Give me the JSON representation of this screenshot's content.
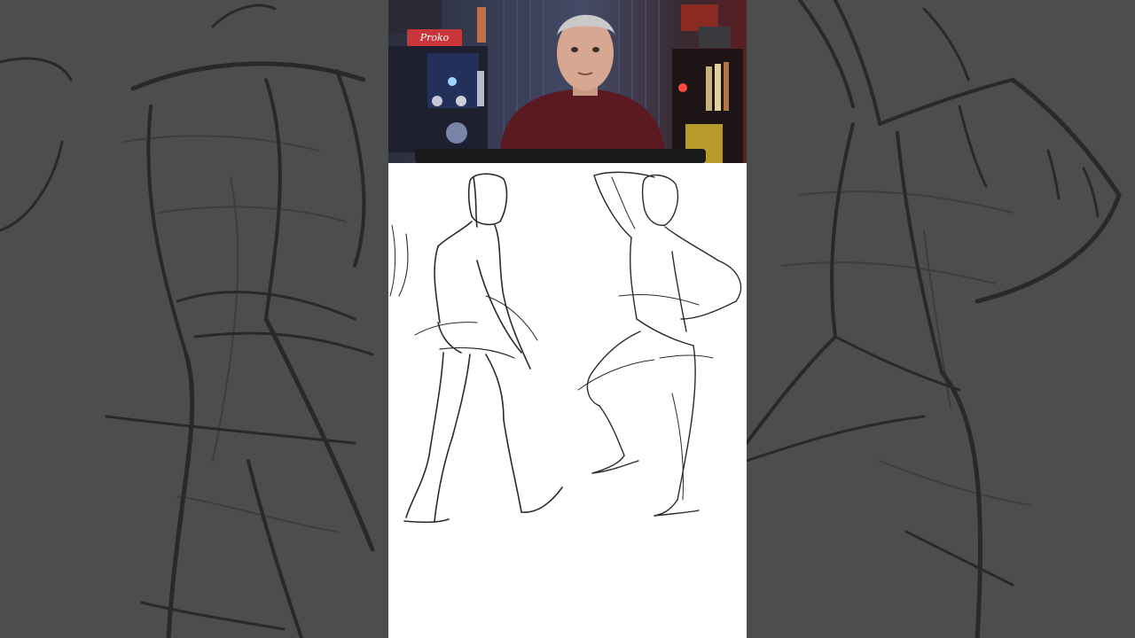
{
  "scene": {
    "webcam": {
      "sign_text": "Proko"
    },
    "icons": {
      "presenter": "person-icon",
      "tablet": "drawing-tablet-icon"
    },
    "colors": {
      "backdrop": "#4d4d4d",
      "canvas": "#ffffff",
      "sweater": "#5b1a22",
      "sign": "#c9363a",
      "stroke": "#2a2a2a"
    }
  }
}
